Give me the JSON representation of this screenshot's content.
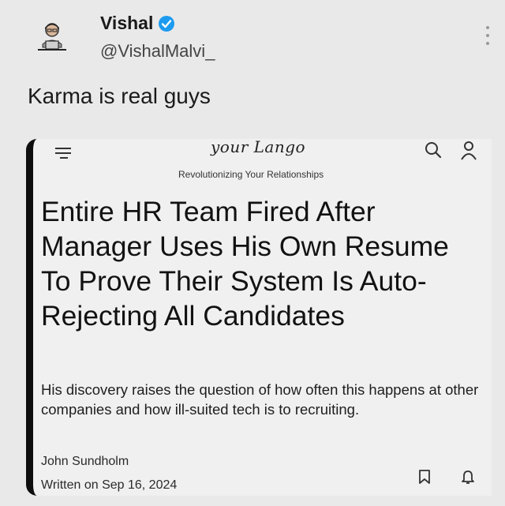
{
  "tweet": {
    "display_name": "Vishal",
    "handle": "@VishalMalvi_",
    "text": "Karma is real guys",
    "verified_color": "#1d9bf0"
  },
  "article_card": {
    "logo_text": "your Lango",
    "tagline": "Revolutionizing Your Relationships",
    "headline": "Entire HR Team Fired After Manager Uses His Own Resume To Prove Their System Is Auto-Rejecting All Candidates",
    "summary": "His discovery raises the question of how often this happens at other companies and how ill-suited tech is to recruiting.",
    "author": "John Sundholm",
    "date": "Written on Sep 16, 2024",
    "icons": [
      "menu-icon",
      "search-icon",
      "user-icon",
      "bookmark-icon",
      "bell-icon"
    ]
  }
}
